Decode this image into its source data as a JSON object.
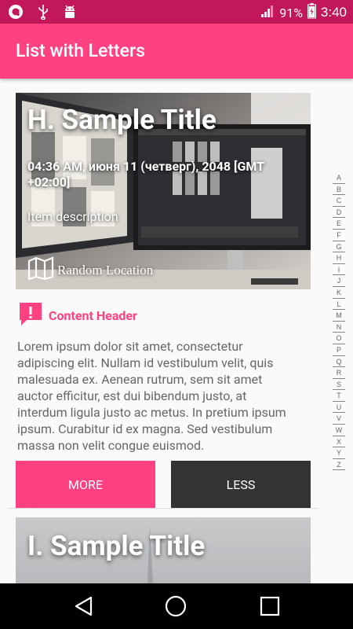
{
  "status_bar": {
    "battery": "91%",
    "time": "3:40",
    "icons": [
      "app-icon",
      "usb-icon",
      "android-debug-icon",
      "signal-icon",
      "battery-icon"
    ]
  },
  "app_bar": {
    "title": "List with Letters"
  },
  "card": {
    "title": "H. Sample Title",
    "datetime": "04:36 AM, июня 11 (четверг), 2048 [GMT +02:00]",
    "description": "Item description",
    "location": "Random Location"
  },
  "content_header": {
    "label": "Content Header",
    "icon": "alert-icon"
  },
  "body_text": "Lorem ipsum dolor sit amet, consectetur adipiscing elit. Nullam id vestibulum velit, quis malesuada ex. Aenean rutrum, sem sit amet auctor efficitur, est dui bibendum justo, at interdum ligula justo ac metus. In pretium ipsum ipsum. Curabitur id ex magna. Sed vestibulum massa non velit congue euismod.",
  "buttons": {
    "more": "MORE",
    "less": "LESS"
  },
  "next_card": {
    "title": "I. Sample Title"
  },
  "index_letters": [
    "A",
    "B",
    "C",
    "D",
    "E",
    "F",
    "G",
    "H",
    "I",
    "J",
    "K",
    "L",
    "M",
    "N",
    "O",
    "P",
    "Q",
    "R",
    "S",
    "T",
    "U",
    "V",
    "W",
    "X",
    "Y",
    "Z"
  ],
  "colors": {
    "accent": "#ff4081",
    "status_bar": "#c2185b",
    "button_dark": "#333333"
  }
}
